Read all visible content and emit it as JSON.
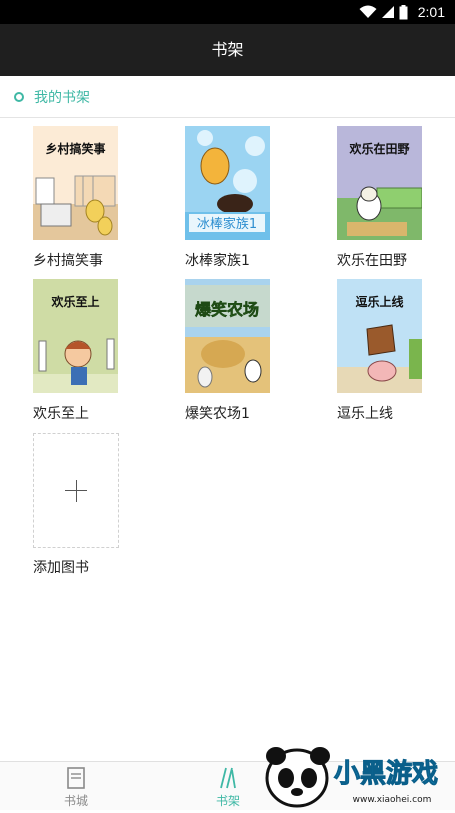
{
  "status_bar": {
    "time": "2:01"
  },
  "header": {
    "title": "书架"
  },
  "section": {
    "title": "我的书架"
  },
  "books": [
    {
      "name": "乡村搞笑事",
      "cover_text": "乡村搞笑事"
    },
    {
      "name": "冰棒家族1",
      "cover_text": "冰棒家族1"
    },
    {
      "name": "欢乐在田野",
      "cover_text": "欢乐在田野"
    },
    {
      "name": "欢乐至上",
      "cover_text": "欢乐至上"
    },
    {
      "name": "爆笑农场1",
      "cover_text": "爆笑农场"
    },
    {
      "name": "逗乐上线",
      "cover_text": "逗乐上线"
    }
  ],
  "add_book": {
    "label": "添加图书"
  },
  "tabs": [
    {
      "label": "书城",
      "icon": "book-icon",
      "active": false
    },
    {
      "label": "书架",
      "icon": "shelf-icon",
      "active": true
    }
  ],
  "watermark": {
    "text": "小黑游戏",
    "url": "www.xiaohei.com"
  },
  "colors": {
    "accent": "#3fb8a5",
    "header_bg": "#1f1f1f",
    "status_bg": "#000000"
  }
}
